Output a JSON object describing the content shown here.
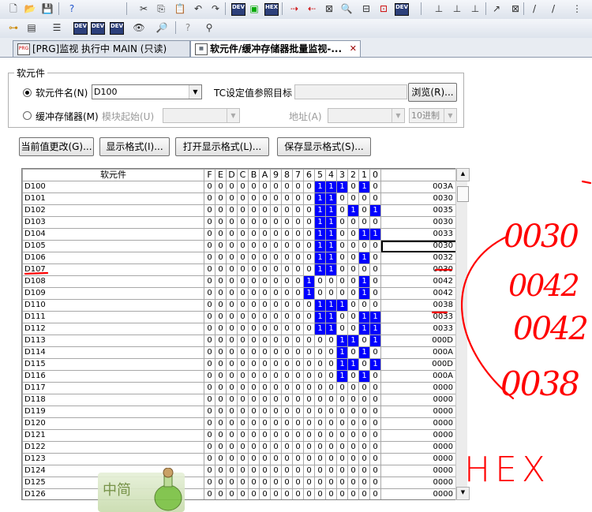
{
  "tab_active_icon": "monitor-window-icon",
  "tabs": [
    {
      "label": "[PRG]监视 执行中 MAIN (只读)",
      "icon": "program-icon"
    },
    {
      "label": "软元件/缓冲存储器批量监视-...",
      "icon": "monitor-window-icon",
      "close": "✕"
    }
  ],
  "device_group": {
    "legend": "软元件",
    "device_radio_label": "软元件名(N)",
    "device_value": "D100",
    "tc_label": "TC设定值参照目标",
    "tc_value": "",
    "browse_label": "浏览(R)...",
    "buffer_radio_label": "缓冲存储器(M)",
    "module_start_label": "模块起始(U)",
    "module_start_value": "",
    "address_label": "地址(A)",
    "address_value": "",
    "radix_value": "10进制",
    "selected": "device"
  },
  "buttons": {
    "change_value": "当前值更改(G)...",
    "display_format": "显示格式(I)...",
    "open_format": "打开显示格式(L)...",
    "save_format": "保存显示格式(S)..."
  },
  "grid": {
    "header_device": "软元件",
    "bit_headers": [
      "F",
      "E",
      "D",
      "C",
      "B",
      "A",
      "9",
      "8",
      "7",
      "6",
      "5",
      "4",
      "3",
      "2",
      "1",
      "0"
    ],
    "rows": [
      {
        "device": "D100",
        "hex": "003A"
      },
      {
        "device": "D101",
        "hex": "0030"
      },
      {
        "device": "D102",
        "hex": "0035"
      },
      {
        "device": "D103",
        "hex": "0030"
      },
      {
        "device": "D104",
        "hex": "0033"
      },
      {
        "device": "D105",
        "hex": "0030",
        "selected": true
      },
      {
        "device": "D106",
        "hex": "0032"
      },
      {
        "device": "D107",
        "hex": "0030"
      },
      {
        "device": "D108",
        "hex": "0042"
      },
      {
        "device": "D109",
        "hex": "0042"
      },
      {
        "device": "D110",
        "hex": "0038"
      },
      {
        "device": "D111",
        "hex": "0033"
      },
      {
        "device": "D112",
        "hex": "0033"
      },
      {
        "device": "D113",
        "hex": "000D"
      },
      {
        "device": "D114",
        "hex": "000A"
      },
      {
        "device": "D115",
        "hex": "000D"
      },
      {
        "device": "D116",
        "hex": "000A"
      },
      {
        "device": "D117",
        "hex": "0000"
      },
      {
        "device": "D118",
        "hex": "0000"
      },
      {
        "device": "D119",
        "hex": "0000"
      },
      {
        "device": "D120",
        "hex": "0000"
      },
      {
        "device": "D121",
        "hex": "0000"
      },
      {
        "device": "D122",
        "hex": "0000"
      },
      {
        "device": "D123",
        "hex": "0000"
      },
      {
        "device": "D124",
        "hex": "0000"
      },
      {
        "device": "D125",
        "hex": "0000"
      },
      {
        "device": "D126",
        "hex": "0000"
      }
    ]
  },
  "watermark": {
    "text": "中简"
  },
  "annotations": {
    "handwritten_values": [
      "0030",
      "0042",
      "0042",
      "0038"
    ],
    "handwritten_label": "HEX"
  },
  "colors": {
    "bit_on": "#0000ff",
    "annotation": "#ff0000"
  }
}
